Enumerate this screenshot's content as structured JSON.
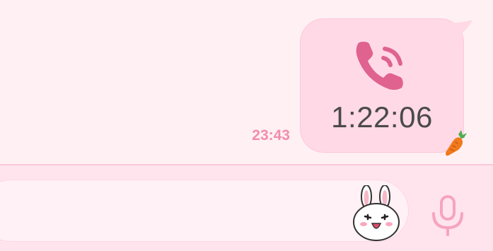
{
  "message": {
    "call_duration": "1:22:06",
    "timestamp": "23:43",
    "call_icon": "phone-call-icon",
    "reaction_icon": "carrot-icon"
  },
  "input_bar": {
    "placeholder": "",
    "sticker_icon": "bunny-sticker-icon",
    "mic_icon": "microphone-icon"
  },
  "colors": {
    "background": "#fff0f4",
    "bubble": "#ffd9e6",
    "accent": "#e0628f",
    "timestamp": "#f28dae",
    "input_bar": "#ffe4ed"
  }
}
